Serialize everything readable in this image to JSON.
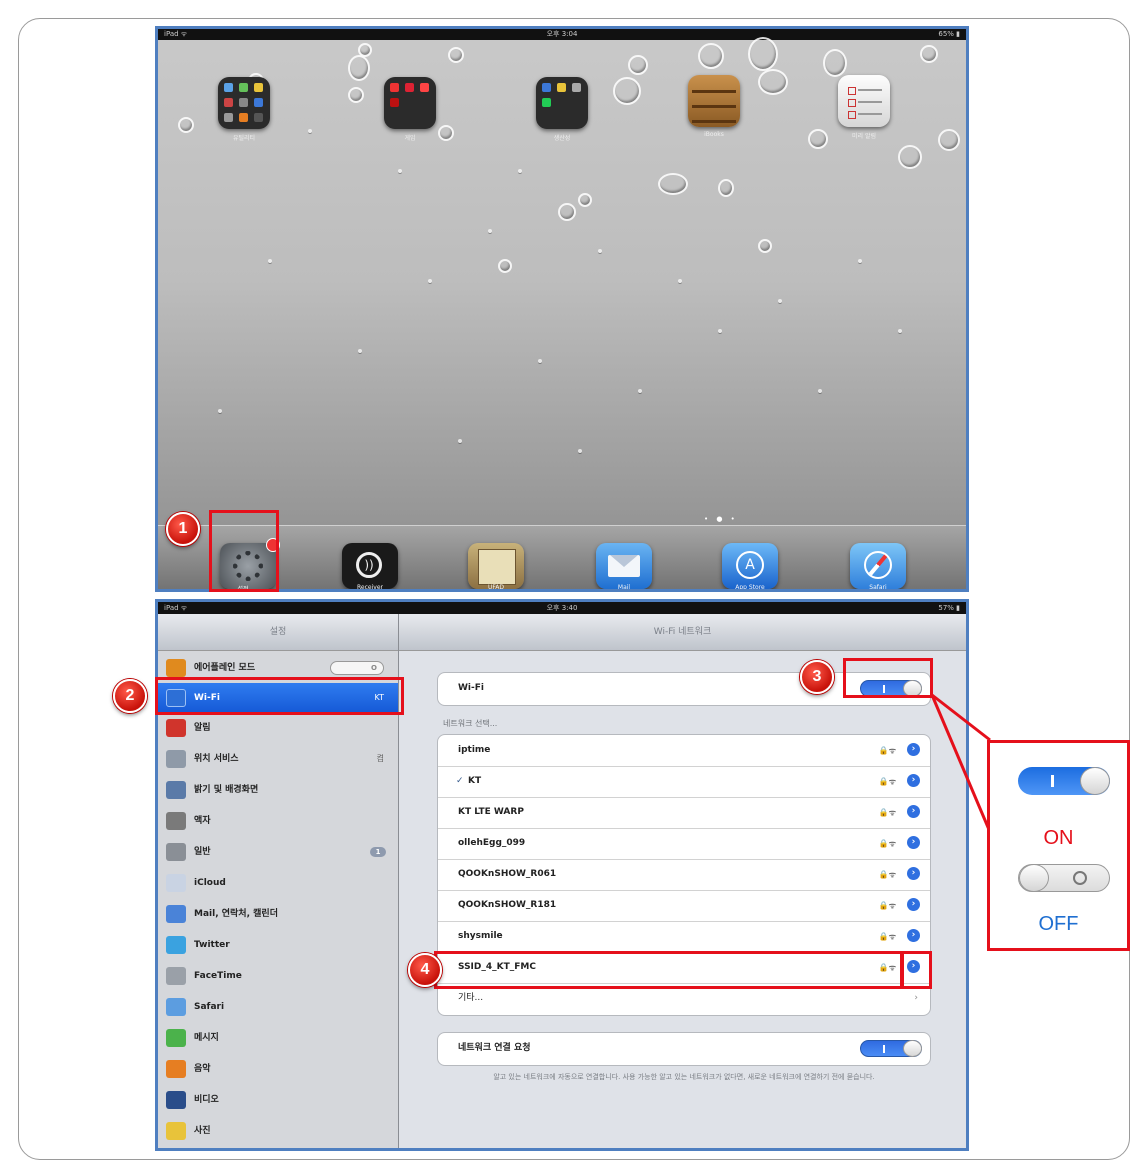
{
  "home": {
    "status_left": "iPad ᯤ",
    "status_center": "오후 3:04",
    "status_right": "65% ▮",
    "folders": [
      {
        "label": "유틸리티"
      },
      {
        "label": "게임"
      },
      {
        "label": "생산성"
      },
      {
        "label": "iBooks"
      },
      {
        "label": "미리 알림"
      }
    ],
    "dock": [
      {
        "label": "설정",
        "icon": "settings-gear-icon"
      },
      {
        "label": "Receiver",
        "icon": "receiver-icon"
      },
      {
        "label": "UFAD",
        "icon": "map-icon"
      },
      {
        "label": "Mail",
        "icon": "mail-icon"
      },
      {
        "label": "App Store",
        "icon": "app-store-icon"
      },
      {
        "label": "Safari",
        "icon": "safari-compass-icon"
      }
    ]
  },
  "settings": {
    "status_left": "iPad ᯤ",
    "status_center": "오후 3:40",
    "status_right": "57% ▮",
    "sidebar_title": "설정",
    "sidebar_items": [
      {
        "label": "에어플레인 모드",
        "value": "O",
        "icon_color": "#e08a1e"
      },
      {
        "label": "Wi-Fi",
        "value": "KT",
        "icon_color": "#2d6fd6"
      },
      {
        "label": "알림",
        "value": "",
        "icon_color": "#d0342c"
      },
      {
        "label": "위치 서비스",
        "value": "켬",
        "icon_color": "#8f9aa8"
      },
      {
        "label": "밝기 및 배경화면",
        "value": "",
        "icon_color": "#5a7aa8"
      },
      {
        "label": "액자",
        "value": "",
        "icon_color": "#7a7a7a"
      },
      {
        "label": "일반",
        "value": "1",
        "icon_color": "#8a8f96"
      },
      {
        "label": "iCloud",
        "value": "",
        "icon_color": "#c9d3e3"
      },
      {
        "label": "Mail, 연락처, 캘린더",
        "value": "",
        "icon_color": "#4a83d8"
      },
      {
        "label": "Twitter",
        "value": "",
        "icon_color": "#3aa2e0"
      },
      {
        "label": "FaceTime",
        "value": "",
        "icon_color": "#9aa0a8"
      },
      {
        "label": "Safari",
        "value": "",
        "icon_color": "#5c9de0"
      },
      {
        "label": "메시지",
        "value": "",
        "icon_color": "#4bb24b"
      },
      {
        "label": "음악",
        "value": "",
        "icon_color": "#e67e22"
      },
      {
        "label": "비디오",
        "value": "",
        "icon_color": "#2a4d8a"
      },
      {
        "label": "사진",
        "value": "",
        "icon_color": "#e8c33a"
      }
    ],
    "main_title": "Wi-Fi 네트워크",
    "wifi_label": "Wi-Fi",
    "network_section": "네트워크 선택...",
    "networks": [
      {
        "name": "iptime",
        "checked": false
      },
      {
        "name": "KT",
        "checked": true
      },
      {
        "name": "KT LTE WARP",
        "checked": false
      },
      {
        "name": "ollehEgg_099",
        "checked": false
      },
      {
        "name": "QOOKnSHOW_R061",
        "checked": false
      },
      {
        "name": "QOOKnSHOW_R181",
        "checked": false
      },
      {
        "name": "shysmile",
        "checked": false
      },
      {
        "name": "SSID_4_KT_FMC",
        "checked": false
      }
    ],
    "other_label": "기타...",
    "ask_join_label": "네트워크 연결 요청",
    "footnote": "알고 있는 네트워크에 자동으로 연결합니다. 사용 가능한 알고 있는 네트워크가 없다면, 새로운 네트워크에 연결하기 전에 묻습니다."
  },
  "annotations": {
    "steps": [
      "1",
      "2",
      "3",
      "4"
    ],
    "on_label": "ON",
    "off_label": "OFF",
    "on_color": "#e5101b",
    "off_color": "#1f6fd1"
  }
}
